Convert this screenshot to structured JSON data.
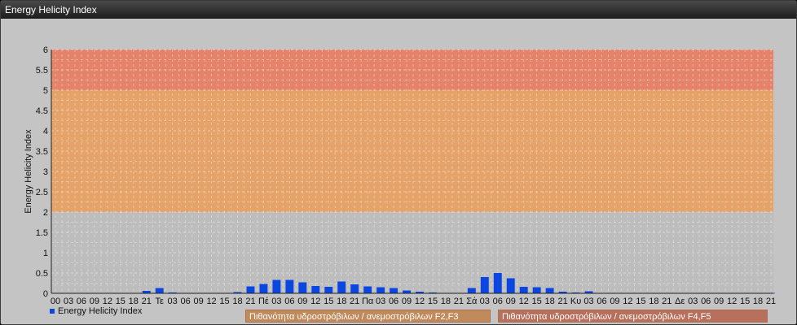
{
  "window": {
    "title": "Energy Helicity Index"
  },
  "legend": {
    "label": "Energy Helicity Index"
  },
  "badges": [
    {
      "label": "Πιθανότητα υδροστρόβιλων / ανεμοστρόβιλων F2,F3",
      "color": "#c08a5c"
    },
    {
      "label": "Πιθανότητα υδροστρόβιλων / ανεμοστρόβιλων F4,F5",
      "color": "#b8705c"
    }
  ],
  "chart_data": {
    "type": "bar",
    "ylabel": "Energy Helicity Index",
    "ylim": [
      0,
      6
    ],
    "yticks": [
      "0",
      "0.5",
      "1",
      "1.5",
      "2",
      "2.5",
      "3",
      "3.5",
      "4",
      "4.5",
      "5",
      "5.5",
      "6"
    ],
    "bands": [
      {
        "from": 0,
        "to": 2,
        "color": "#bdbdbd"
      },
      {
        "from": 2,
        "to": 5,
        "color": "#e5a36a"
      },
      {
        "from": 5,
        "to": 6,
        "color": "#e5836a"
      }
    ],
    "bar_color": "#0b46e0",
    "categories": [
      "00",
      "03",
      "06",
      "09",
      "12",
      "15",
      "18",
      "21",
      "Τε",
      "03",
      "06",
      "09",
      "12",
      "15",
      "18",
      "21",
      "Πέ",
      "03",
      "06",
      "09",
      "12",
      "15",
      "18",
      "21",
      "Πα",
      "03",
      "06",
      "09",
      "12",
      "15",
      "18",
      "21",
      "Σά",
      "03",
      "06",
      "09",
      "12",
      "15",
      "18",
      "21",
      "Κυ",
      "03",
      "06",
      "09",
      "12",
      "15",
      "18",
      "21",
      "Δε",
      "03",
      "06",
      "09",
      "12",
      "15",
      "18",
      "21"
    ],
    "values": [
      0.01,
      0.01,
      0.01,
      0.01,
      0.01,
      0.01,
      0.01,
      0.06,
      0.13,
      0.02,
      0.01,
      0.01,
      0.01,
      0.01,
      0.03,
      0.17,
      0.23,
      0.33,
      0.33,
      0.27,
      0.18,
      0.16,
      0.29,
      0.22,
      0.17,
      0.15,
      0.13,
      0.07,
      0.04,
      0.02,
      0.01,
      0.01,
      0.13,
      0.4,
      0.5,
      0.37,
      0.16,
      0.15,
      0.13,
      0.04,
      0.02,
      0.05,
      0.01,
      0.01,
      0.01,
      0.01,
      0.01,
      0.01,
      0.01,
      0.01,
      0.01,
      0.01,
      0.01,
      0.01,
      0.01,
      0.01
    ]
  }
}
